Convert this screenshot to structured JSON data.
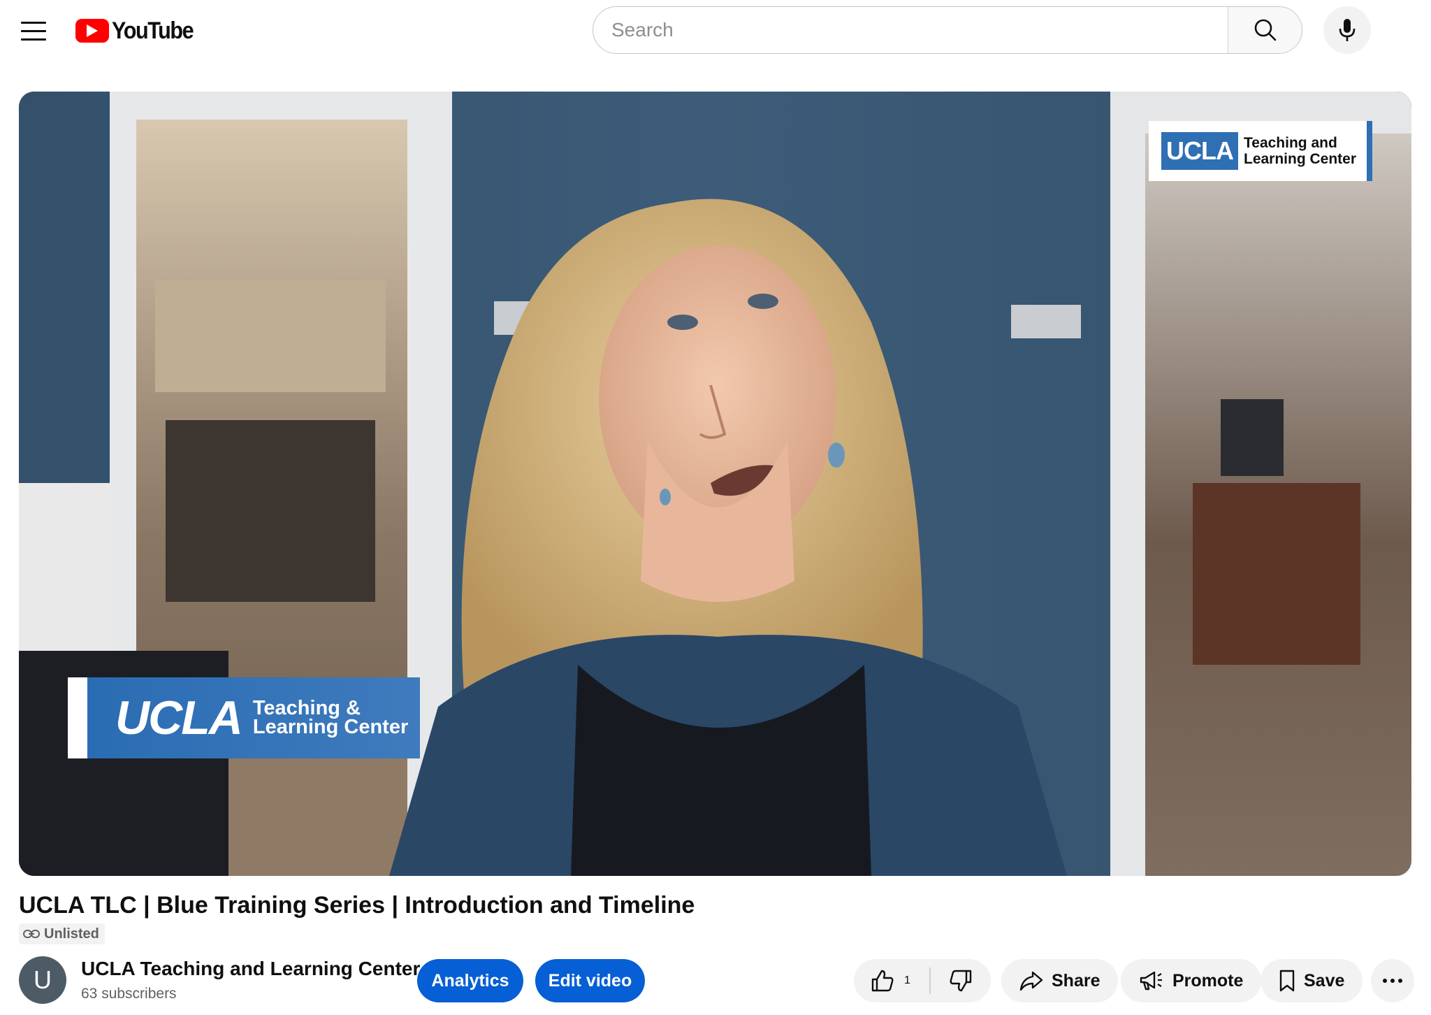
{
  "header": {
    "logo_text": "YouTube",
    "search_placeholder": "Search"
  },
  "video": {
    "overlay_lower_third": {
      "brand": "UCLA",
      "subtitle": "Teaching &\nLearning Center"
    },
    "overlay_corner_logo": {
      "brand": "UCLA",
      "subtitle": "Teaching and\nLearning Center"
    }
  },
  "info": {
    "title": "UCLA TLC | Blue Training Series | Introduction and Timeline",
    "visibility": "Unlisted",
    "channel": {
      "avatar_letter": "U",
      "name": "UCLA Teaching and Learning Center",
      "subscribers": "63 subscribers"
    },
    "buttons": {
      "analytics": "Analytics",
      "edit_video": "Edit video",
      "like_count": "1",
      "share": "Share",
      "promote": "Promote",
      "save": "Save"
    }
  },
  "colors": {
    "brand_red": "#ff0000",
    "primary_blue": "#065fd4",
    "ucla_blue": "#2f6fb4"
  }
}
